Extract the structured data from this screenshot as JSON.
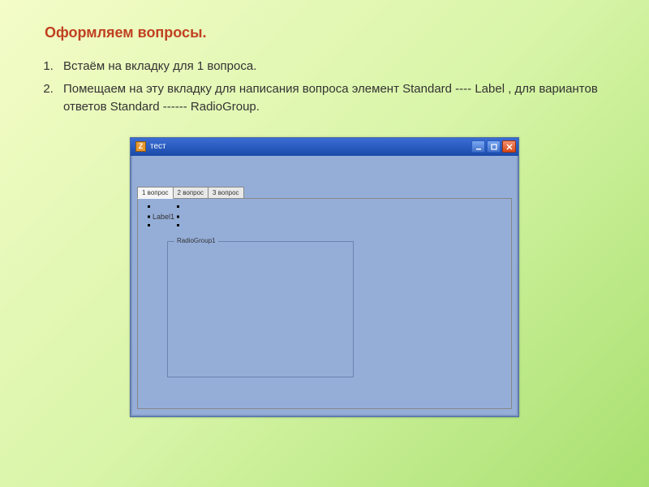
{
  "heading": "Оформляем вопросы.",
  "instructions": {
    "item1": "Встаём на вкладку для 1 вопроса.",
    "item2": "Помещаем на эту вкладку для написания вопроса элемент  Standard ---- Label  , для вариантов ответов  Standard ------ RadioGroup."
  },
  "window": {
    "app_icon_letter": "Z",
    "title": "тест",
    "tabs": {
      "t1": "1 вопрос",
      "t2": "2 вопрос",
      "t3": "3 вопрос"
    },
    "label_widget": "Label1",
    "radiogroup_caption": "RadioGroup1",
    "buttons": {
      "min": "_",
      "max": "□",
      "close": "×"
    }
  }
}
